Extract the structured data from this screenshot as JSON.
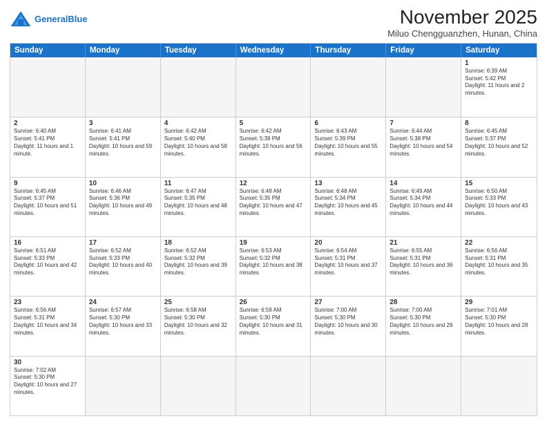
{
  "header": {
    "logo_general": "General",
    "logo_blue": "Blue",
    "month_title": "November 2025",
    "location": "Miluo Chengguanzhen, Hunan, China"
  },
  "days_of_week": [
    "Sunday",
    "Monday",
    "Tuesday",
    "Wednesday",
    "Thursday",
    "Friday",
    "Saturday"
  ],
  "weeks": [
    [
      {
        "day": "",
        "empty": true
      },
      {
        "day": "",
        "empty": true
      },
      {
        "day": "",
        "empty": true
      },
      {
        "day": "",
        "empty": true
      },
      {
        "day": "",
        "empty": true
      },
      {
        "day": "",
        "empty": true
      },
      {
        "day": "1",
        "sunrise": "6:39 AM",
        "sunset": "5:42 PM",
        "daylight": "11 hours and 2 minutes."
      }
    ],
    [
      {
        "day": "2",
        "sunrise": "6:40 AM",
        "sunset": "5:41 PM",
        "daylight": "11 hours and 1 minute."
      },
      {
        "day": "3",
        "sunrise": "6:41 AM",
        "sunset": "5:41 PM",
        "daylight": "10 hours and 59 minutes."
      },
      {
        "day": "4",
        "sunrise": "6:42 AM",
        "sunset": "5:40 PM",
        "daylight": "10 hours and 58 minutes."
      },
      {
        "day": "5",
        "sunrise": "6:42 AM",
        "sunset": "5:39 PM",
        "daylight": "10 hours and 56 minutes."
      },
      {
        "day": "6",
        "sunrise": "6:43 AM",
        "sunset": "5:39 PM",
        "daylight": "10 hours and 55 minutes."
      },
      {
        "day": "7",
        "sunrise": "6:44 AM",
        "sunset": "5:38 PM",
        "daylight": "10 hours and 54 minutes."
      },
      {
        "day": "8",
        "sunrise": "6:45 AM",
        "sunset": "5:37 PM",
        "daylight": "10 hours and 52 minutes."
      }
    ],
    [
      {
        "day": "9",
        "sunrise": "6:45 AM",
        "sunset": "5:37 PM",
        "daylight": "10 hours and 51 minutes."
      },
      {
        "day": "10",
        "sunrise": "6:46 AM",
        "sunset": "5:36 PM",
        "daylight": "10 hours and 49 minutes."
      },
      {
        "day": "11",
        "sunrise": "6:47 AM",
        "sunset": "5:35 PM",
        "daylight": "10 hours and 48 minutes."
      },
      {
        "day": "12",
        "sunrise": "6:48 AM",
        "sunset": "5:35 PM",
        "daylight": "10 hours and 47 minutes."
      },
      {
        "day": "13",
        "sunrise": "6:48 AM",
        "sunset": "5:34 PM",
        "daylight": "10 hours and 45 minutes."
      },
      {
        "day": "14",
        "sunrise": "6:49 AM",
        "sunset": "5:34 PM",
        "daylight": "10 hours and 44 minutes."
      },
      {
        "day": "15",
        "sunrise": "6:50 AM",
        "sunset": "5:33 PM",
        "daylight": "10 hours and 43 minutes."
      }
    ],
    [
      {
        "day": "16",
        "sunrise": "6:51 AM",
        "sunset": "5:33 PM",
        "daylight": "10 hours and 42 minutes."
      },
      {
        "day": "17",
        "sunrise": "6:52 AM",
        "sunset": "5:33 PM",
        "daylight": "10 hours and 40 minutes."
      },
      {
        "day": "18",
        "sunrise": "6:52 AM",
        "sunset": "5:32 PM",
        "daylight": "10 hours and 39 minutes."
      },
      {
        "day": "19",
        "sunrise": "6:53 AM",
        "sunset": "5:32 PM",
        "daylight": "10 hours and 38 minutes."
      },
      {
        "day": "20",
        "sunrise": "6:54 AM",
        "sunset": "5:31 PM",
        "daylight": "10 hours and 37 minutes."
      },
      {
        "day": "21",
        "sunrise": "6:55 AM",
        "sunset": "5:31 PM",
        "daylight": "10 hours and 36 minutes."
      },
      {
        "day": "22",
        "sunrise": "6:56 AM",
        "sunset": "5:31 PM",
        "daylight": "10 hours and 35 minutes."
      }
    ],
    [
      {
        "day": "23",
        "sunrise": "6:56 AM",
        "sunset": "5:31 PM",
        "daylight": "10 hours and 34 minutes."
      },
      {
        "day": "24",
        "sunrise": "6:57 AM",
        "sunset": "5:30 PM",
        "daylight": "10 hours and 33 minutes."
      },
      {
        "day": "25",
        "sunrise": "6:58 AM",
        "sunset": "5:30 PM",
        "daylight": "10 hours and 32 minutes."
      },
      {
        "day": "26",
        "sunrise": "6:59 AM",
        "sunset": "5:30 PM",
        "daylight": "10 hours and 31 minutes."
      },
      {
        "day": "27",
        "sunrise": "7:00 AM",
        "sunset": "5:30 PM",
        "daylight": "10 hours and 30 minutes."
      },
      {
        "day": "28",
        "sunrise": "7:00 AM",
        "sunset": "5:30 PM",
        "daylight": "10 hours and 29 minutes."
      },
      {
        "day": "29",
        "sunrise": "7:01 AM",
        "sunset": "5:30 PM",
        "daylight": "10 hours and 28 minutes."
      }
    ],
    [
      {
        "day": "30",
        "sunrise": "7:02 AM",
        "sunset": "5:30 PM",
        "daylight": "10 hours and 27 minutes."
      },
      {
        "day": "",
        "empty": true
      },
      {
        "day": "",
        "empty": true
      },
      {
        "day": "",
        "empty": true
      },
      {
        "day": "",
        "empty": true
      },
      {
        "day": "",
        "empty": true
      },
      {
        "day": "",
        "empty": true
      }
    ]
  ]
}
